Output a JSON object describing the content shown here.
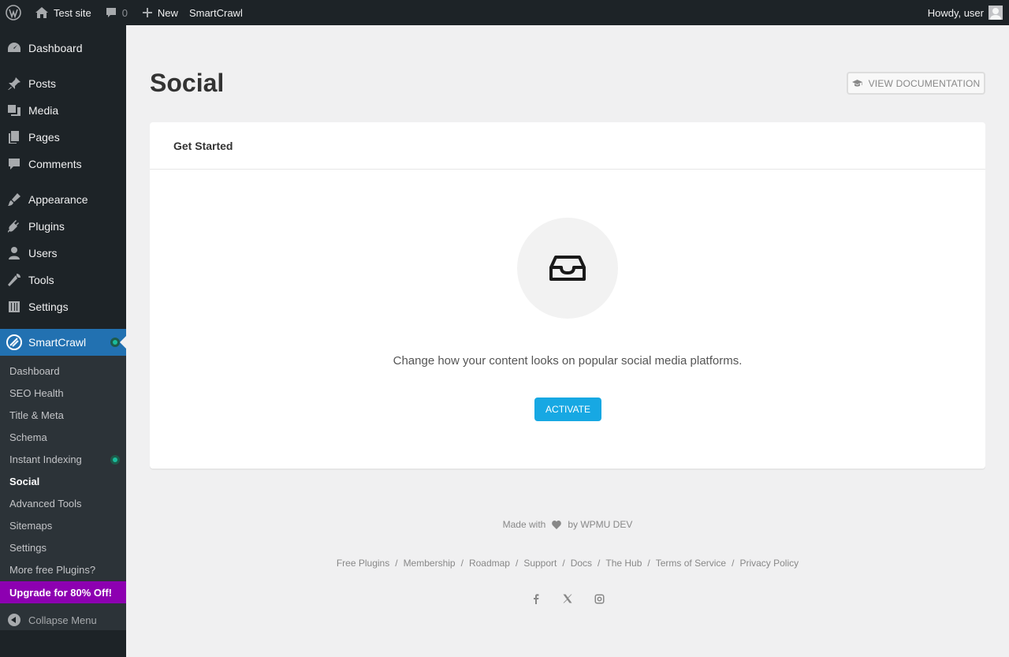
{
  "admin_bar": {
    "site_name": "Test site",
    "comments_count": "0",
    "new_label": "New",
    "plugin_label": "SmartCrawl",
    "greeting": "Howdy, user"
  },
  "sidebar": {
    "items": [
      {
        "label": "Dashboard",
        "icon": "dashboard-icon"
      },
      {
        "label": "Posts",
        "icon": "pin-icon"
      },
      {
        "label": "Media",
        "icon": "media-icon"
      },
      {
        "label": "Pages",
        "icon": "pages-icon"
      },
      {
        "label": "Comments",
        "icon": "comment-icon"
      },
      {
        "label": "Appearance",
        "icon": "brush-icon"
      },
      {
        "label": "Plugins",
        "icon": "plug-icon"
      },
      {
        "label": "Users",
        "icon": "user-icon"
      },
      {
        "label": "Tools",
        "icon": "wrench-icon"
      },
      {
        "label": "Settings",
        "icon": "sliders-icon"
      },
      {
        "label": "SmartCrawl",
        "icon": "smartcrawl-icon"
      }
    ],
    "submenu": [
      {
        "label": "Dashboard"
      },
      {
        "label": "SEO Health"
      },
      {
        "label": "Title & Meta"
      },
      {
        "label": "Schema"
      },
      {
        "label": "Instant Indexing"
      },
      {
        "label": "Social"
      },
      {
        "label": "Advanced Tools"
      },
      {
        "label": "Sitemaps"
      },
      {
        "label": "Settings"
      },
      {
        "label": "More free Plugins?"
      },
      {
        "label": "Upgrade for 80% Off!"
      }
    ],
    "collapse_label": "Collapse Menu"
  },
  "main": {
    "title": "Social",
    "doc_button": "VIEW DOCUMENTATION",
    "card_title": "Get Started",
    "description": "Change how your content looks on popular social media platforms.",
    "activate_label": "ACTIVATE"
  },
  "footer": {
    "made_with": "Made with",
    "by": "by WPMU DEV",
    "links": [
      "Free Plugins",
      "Membership",
      "Roadmap",
      "Support",
      "Docs",
      "The Hub",
      "Terms of Service",
      "Privacy Policy"
    ]
  },
  "colors": {
    "admin_bar": "#1d2327",
    "current_menu": "#2271b1",
    "upgrade": "#8d00b1",
    "activate": "#17a8e3"
  }
}
